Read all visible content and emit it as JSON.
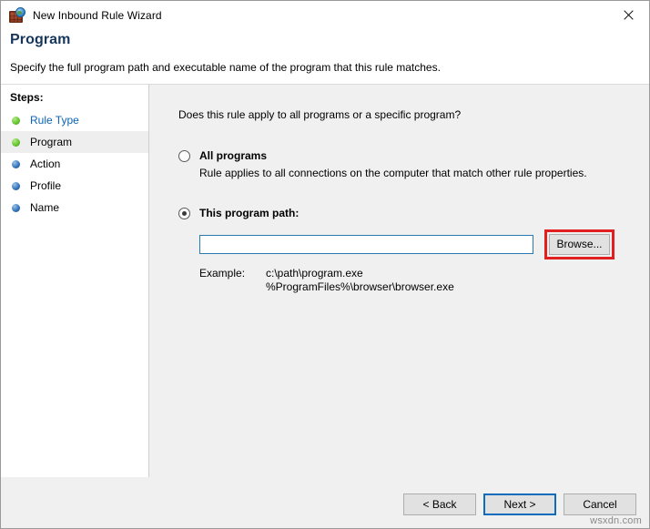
{
  "window": {
    "title": "New Inbound Rule Wizard",
    "icon": "firewall-icon",
    "close_label": "✕"
  },
  "header": {
    "title": "Program",
    "subtitle": "Specify the full program path and executable name of the program that this rule matches."
  },
  "sidebar": {
    "heading": "Steps:",
    "items": [
      {
        "label": "Rule Type",
        "state": "completed",
        "bullet": "green"
      },
      {
        "label": "Program",
        "state": "current",
        "bullet": "green"
      },
      {
        "label": "Action",
        "state": "pending",
        "bullet": "blue"
      },
      {
        "label": "Profile",
        "state": "pending",
        "bullet": "blue"
      },
      {
        "label": "Name",
        "state": "pending",
        "bullet": "blue"
      }
    ]
  },
  "main": {
    "question": "Does this rule apply to all programs or a specific program?",
    "all_programs": {
      "label": "All programs",
      "description": "Rule applies to all connections on the computer that match other rule properties.",
      "selected": false
    },
    "program_path": {
      "label": "This program path:",
      "selected": true,
      "input_value": "",
      "input_placeholder": "",
      "browse_label": "Browse...",
      "browse_highlight_color": "#e02020"
    },
    "example": {
      "label": "Example:",
      "lines": "c:\\path\\program.exe\n%ProgramFiles%\\browser\\browser.exe",
      "line1": "c:\\path\\program.exe",
      "line2": "%ProgramFiles%\\browser\\browser.exe"
    }
  },
  "footer": {
    "back_label": "< Back",
    "next_label": "Next >",
    "cancel_label": "Cancel"
  },
  "watermark": "wsxdn.com",
  "colors": {
    "header_title": "#17365d",
    "link": "#0b63b5",
    "input_border": "#2a7ab0",
    "highlight": "#e02020",
    "default_button_border": "#0f6cbd",
    "panel_bg": "#f0f0f0"
  }
}
